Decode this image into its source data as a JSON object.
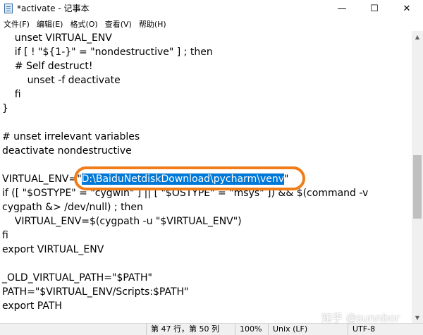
{
  "window": {
    "title": "*activate - 记事本",
    "minimize_glyph": "—",
    "maximize_glyph": "☐",
    "close_glyph": "✕"
  },
  "menu": {
    "items": [
      "文件(F)",
      "编辑(E)",
      "格式(O)",
      "查看(V)",
      "帮助(H)"
    ]
  },
  "editor": {
    "lines": [
      "    unset VIRTUAL_ENV",
      "    if [ ! \"${1-}\" = \"nondestructive\" ] ; then",
      "    # Self destruct!",
      "        unset -f deactivate",
      "    fi",
      "}",
      "",
      "# unset irrelevant variables",
      "deactivate nondestructive",
      "",
      "",
      "if ([ \"$OSTYPE\" = \"cygwin\" ] || [ \"$OSTYPE\" = \"msys\" ]) && $(command -v",
      "cygpath &> /dev/null) ; then",
      "    VIRTUAL_ENV=$(cygpath -u \"$VIRTUAL_ENV\")",
      "fi",
      "export VIRTUAL_ENV",
      "",
      "_OLD_VIRTUAL_PATH=\"$PATH\"",
      "PATH=\"$VIRTUAL_ENV/Scripts:$PATH\"",
      "export PATH"
    ],
    "selected_line": {
      "prefix": "VIRTUAL_ENV=\"",
      "selected": "D:\\BaiduNetdiskDownload\\pycharm\\venv",
      "suffix": "\""
    }
  },
  "scrollbar": {
    "up_glyph": "▲",
    "down_glyph": "▼"
  },
  "status": {
    "position": "第 47 行，第 50 列",
    "zoom": "100%",
    "line_ending": "Unix (LF)",
    "encoding": "UTF-8"
  },
  "watermark": "知乎 @sunnbor",
  "colors": {
    "selection": "#0078d7",
    "annotation_ring": "#f07d1a"
  }
}
